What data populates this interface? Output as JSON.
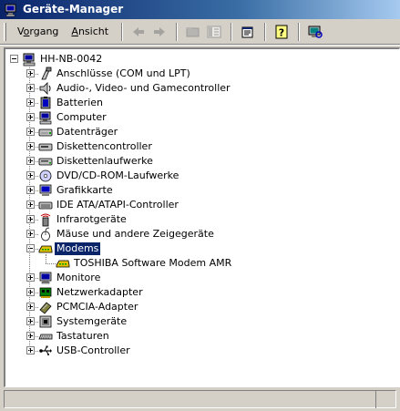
{
  "window": {
    "title": "Geräte-Manager",
    "accent": "#0a246a"
  },
  "menu": {
    "items": [
      {
        "id": "vorgang",
        "label": "Vorgang",
        "mnemonic": "o"
      },
      {
        "id": "ansicht",
        "label": "Ansicht",
        "mnemonic": "A"
      }
    ]
  },
  "toolbar": {
    "buttons": [
      {
        "id": "back",
        "icon": "arrow-left-icon",
        "enabled": false
      },
      {
        "id": "forward",
        "icon": "arrow-right-icon",
        "enabled": false
      },
      {
        "id": "up",
        "icon": "folder-up-icon",
        "enabled": false
      },
      {
        "id": "show-hide",
        "icon": "show-hide-tree-icon",
        "enabled": false
      },
      {
        "id": "properties",
        "icon": "properties-icon",
        "enabled": true
      },
      {
        "id": "help",
        "icon": "help-icon",
        "enabled": true
      },
      {
        "id": "scan",
        "icon": "scan-hardware-icon",
        "enabled": true
      }
    ]
  },
  "tree": {
    "root": {
      "label": "HH-NB-0042",
      "icon": "computer-icon"
    },
    "categories": [
      {
        "label": "Anschlüsse (COM und LPT)",
        "icon": "port-icon",
        "expanded": false
      },
      {
        "label": "Audio-, Video- und Gamecontroller",
        "icon": "speaker-icon",
        "expanded": false
      },
      {
        "label": "Batterien",
        "icon": "battery-icon",
        "expanded": false
      },
      {
        "label": "Computer",
        "icon": "computer-icon",
        "expanded": false
      },
      {
        "label": "Datenträger",
        "icon": "disk-drive-icon",
        "expanded": false
      },
      {
        "label": "Diskettencontroller",
        "icon": "floppy-controller-icon",
        "expanded": false
      },
      {
        "label": "Diskettenlaufwerke",
        "icon": "floppy-drive-icon",
        "expanded": false
      },
      {
        "label": "DVD/CD-ROM-Laufwerke",
        "icon": "cdrom-icon",
        "expanded": false
      },
      {
        "label": "Grafikkarte",
        "icon": "display-adapter-icon",
        "expanded": false
      },
      {
        "label": "IDE ATA/ATAPI-Controller",
        "icon": "ide-controller-icon",
        "expanded": false
      },
      {
        "label": "Infrarotgeräte",
        "icon": "infrared-icon",
        "expanded": false
      },
      {
        "label": "Mäuse und andere Zeigegeräte",
        "icon": "mouse-icon",
        "expanded": false
      },
      {
        "label": "Modems",
        "icon": "modem-icon",
        "expanded": true,
        "selected": true,
        "children": [
          {
            "label": "TOSHIBA Software Modem AMR",
            "icon": "modem-icon"
          }
        ]
      },
      {
        "label": "Monitore",
        "icon": "monitor-icon",
        "expanded": false
      },
      {
        "label": "Netzwerkadapter",
        "icon": "network-adapter-icon",
        "expanded": false
      },
      {
        "label": "PCMCIA-Adapter",
        "icon": "pcmcia-icon",
        "expanded": false
      },
      {
        "label": "Systemgeräte",
        "icon": "system-device-icon",
        "expanded": false
      },
      {
        "label": "Tastaturen",
        "icon": "keyboard-icon",
        "expanded": false
      },
      {
        "label": "USB-Controller",
        "icon": "usb-icon",
        "expanded": false
      }
    ]
  },
  "statusbar": {
    "text": ""
  }
}
